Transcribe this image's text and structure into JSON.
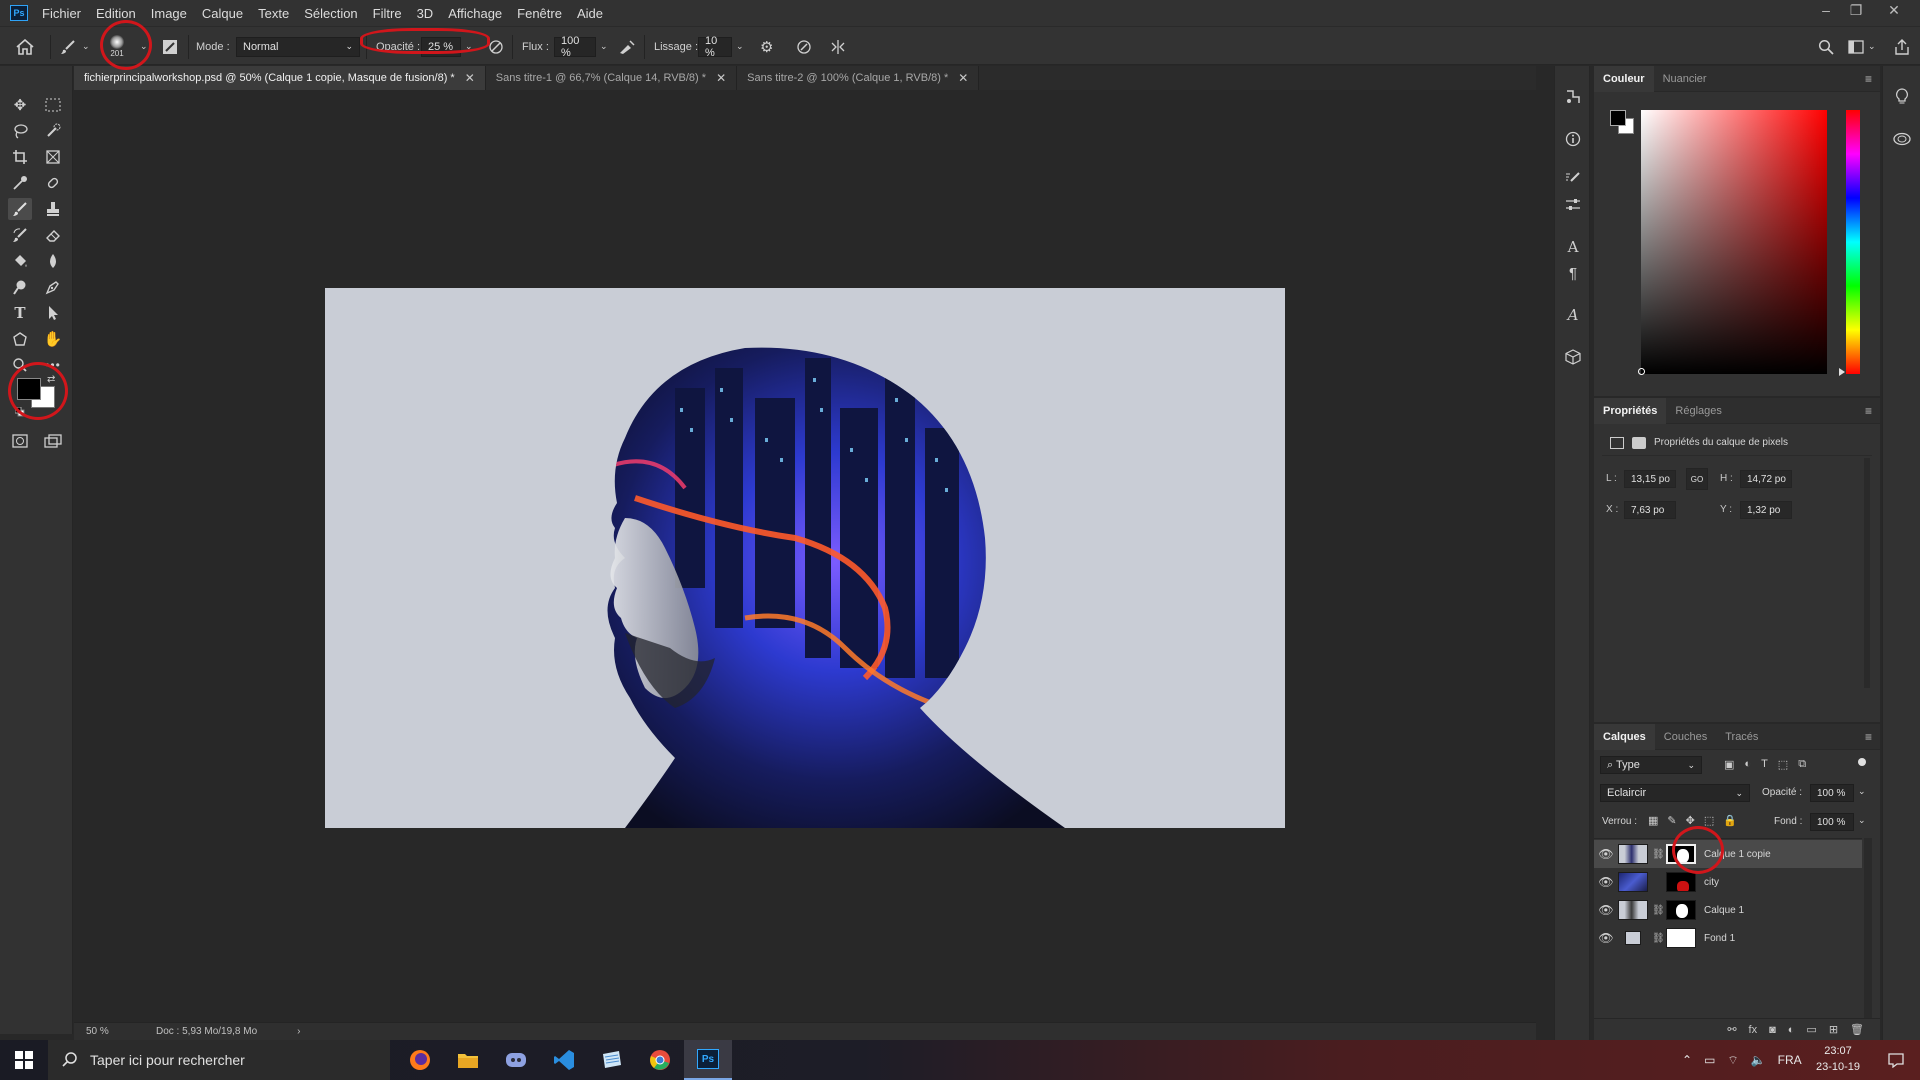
{
  "app": {
    "logo_text": "Ps"
  },
  "menu": [
    "Fichier",
    "Edition",
    "Image",
    "Calque",
    "Texte",
    "Sélection",
    "Filtre",
    "3D",
    "Affichage",
    "Fenêtre",
    "Aide"
  ],
  "window_controls": {
    "minimize": "–",
    "restore": "❐",
    "close": "✕"
  },
  "options": {
    "brush_size": "201",
    "mode_label": "Mode :",
    "mode_value": "Normal",
    "opacity_label": "Opacité :",
    "opacity_value": "25 %",
    "flux_label": "Flux :",
    "flux_value": "100 %",
    "lissage_label": "Lissage :",
    "lissage_value": "10 %"
  },
  "tabs": [
    {
      "label": "fichierprincipalworkshop.psd @ 50% (Calque 1 copie, Masque de fusion/8) *",
      "active": true
    },
    {
      "label": "Sans titre-1 @ 66,7% (Calque 14, RVB/8) *",
      "active": false
    },
    {
      "label": "Sans titre-2 @ 100% (Calque 1, RVB/8) *",
      "active": false
    }
  ],
  "status": {
    "zoom": "50 %",
    "doc": "Doc : 5,93 Mo/19,8 Mo",
    "arrow": "›"
  },
  "color_panel": {
    "tabs": [
      "Couleur",
      "Nuancier"
    ],
    "foreground": "#000000",
    "background": "#ffffff",
    "hue": "#ff0000"
  },
  "properties_panel": {
    "tabs": [
      "Propriétés",
      "Réglages"
    ],
    "subtitle": "Propriétés du calque de pixels",
    "l_label": "L :",
    "l_value": "13,15 po",
    "h_label": "H :",
    "h_value": "14,72 po",
    "x_label": "X :",
    "x_value": "7,63 po",
    "y_label": "Y :",
    "y_value": "1,32 po",
    "link_label": "GO"
  },
  "layers_panel": {
    "tabs": [
      "Calques",
      "Couches",
      "Tracés"
    ],
    "filter_value": "Type",
    "blend_mode": "Eclaircir",
    "opacity_label": "Opacité :",
    "opacity_value": "100 %",
    "lock_label": "Verrou :",
    "fill_label": "Fond :",
    "fill_value": "100 %",
    "layers": [
      {
        "name": "Calque 1 copie",
        "selected": true
      },
      {
        "name": "city",
        "selected": false
      },
      {
        "name": "Calque 1",
        "selected": false
      },
      {
        "name": "Fond 1",
        "selected": false
      }
    ],
    "footer_icons": [
      "link-icon",
      "fx-icon",
      "mask-icon",
      "adjustment-icon",
      "folder-icon",
      "new-layer-icon",
      "trash-icon"
    ]
  },
  "taskbar": {
    "search_placeholder": "Taper ici pour rechercher",
    "lang": "FRA",
    "time": "23:07",
    "date": "23-10-19"
  }
}
